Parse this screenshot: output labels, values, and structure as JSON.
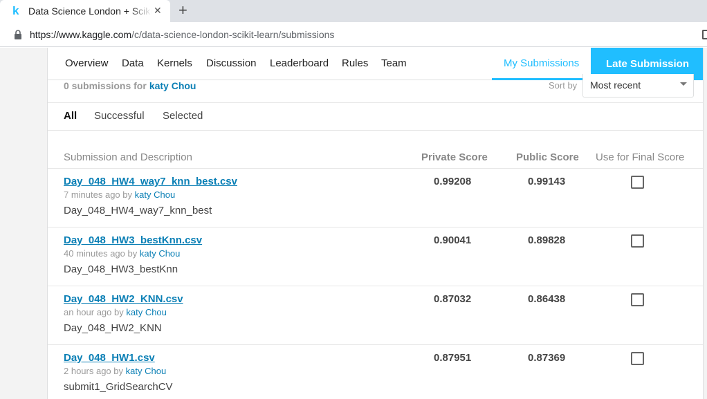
{
  "browser": {
    "tab_title": "Data Science London + Scikit-learn",
    "favicon_letter": "k",
    "close_glyph": "✕",
    "new_tab_glyph": "+",
    "url_host": "https://www.kaggle.com",
    "url_path": "/c/data-science-london-scikit-learn/submissions"
  },
  "nav": {
    "items": [
      "Overview",
      "Data",
      "Kernels",
      "Discussion",
      "Leaderboard",
      "Rules",
      "Team"
    ],
    "active": "My Submissions",
    "late_submission": "Late Submission"
  },
  "summary": {
    "count_text": "0 submissions for",
    "user": "katy Chou"
  },
  "sort": {
    "label": "Sort by",
    "value": "Most recent"
  },
  "filters": [
    "All",
    "Successful",
    "Selected"
  ],
  "active_filter": "All",
  "table": {
    "headers": {
      "submission": "Submission and Description",
      "private": "Private Score",
      "public": "Public Score",
      "final": "Use for Final Score"
    },
    "rows": [
      {
        "file": "Day_048_HW4_way7_knn_best.csv",
        "time": "7 minutes ago by",
        "user": "katy Chou",
        "desc": "Day_048_HW4_way7_knn_best",
        "private": "0.99208",
        "public": "0.99143"
      },
      {
        "file": "Day_048_HW3_bestKnn.csv",
        "time": "40 minutes ago by",
        "user": "katy Chou",
        "desc": "Day_048_HW3_bestKnn",
        "private": "0.90041",
        "public": "0.89828"
      },
      {
        "file": "Day_048_HW2_KNN.csv",
        "time": "an hour ago by",
        "user": "katy Chou",
        "desc": "Day_048_HW2_KNN",
        "private": "0.87032",
        "public": "0.86438"
      },
      {
        "file": "Day_048_HW1.csv",
        "time": "2 hours ago by",
        "user": "katy Chou",
        "desc": "submit1_GridSearchCV",
        "private": "0.87951",
        "public": "0.87369"
      }
    ]
  },
  "colors": {
    "accent": "#20beff",
    "link": "#0a7fb5"
  }
}
